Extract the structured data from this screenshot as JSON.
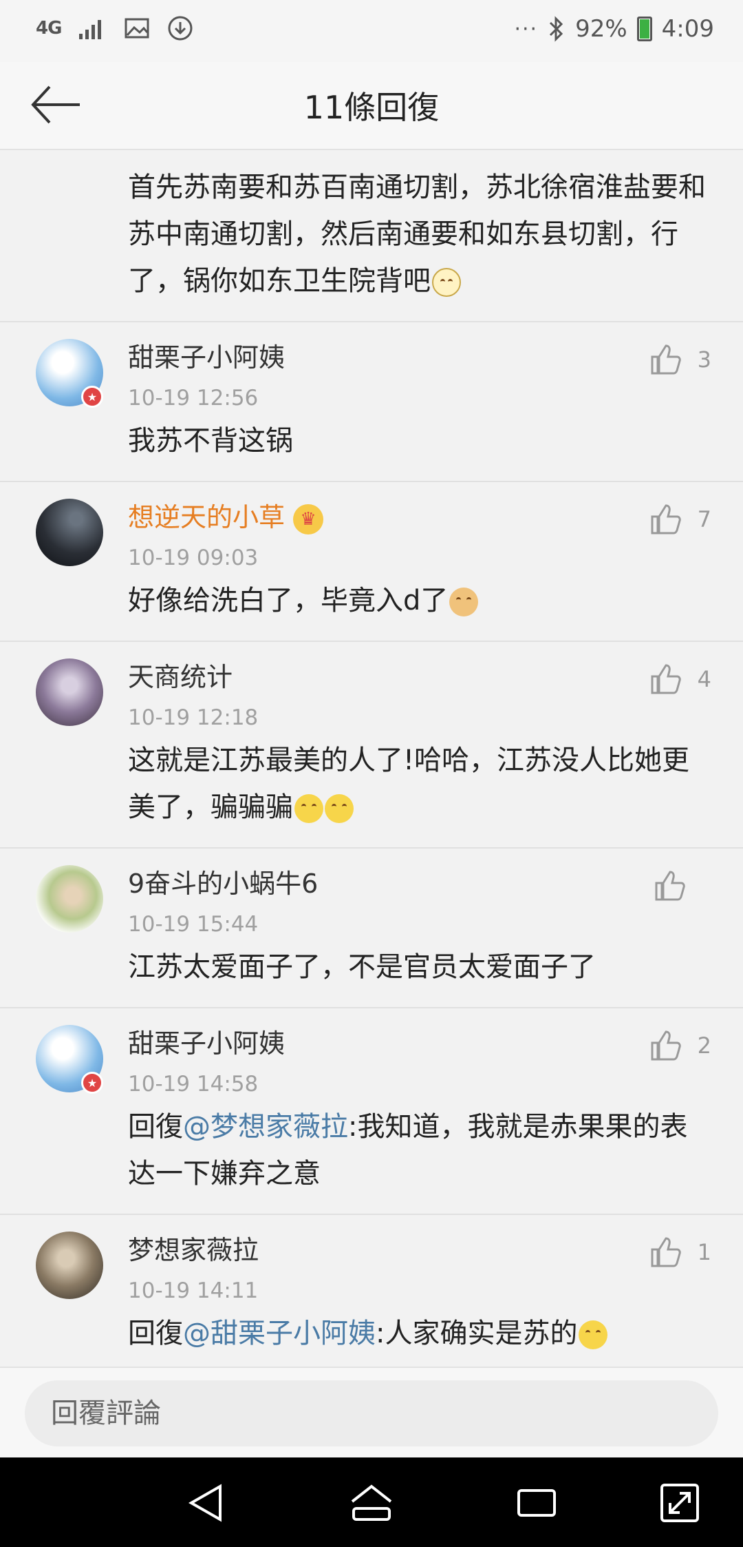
{
  "status_bar": {
    "network": "4G",
    "battery_pct": "92%",
    "time": "4:09",
    "battery_level": 0.92
  },
  "header": {
    "title": "11條回復"
  },
  "top_comment": {
    "text": "首先苏南要和苏百南通切割，苏北徐宿淮盐要和苏中南通切割，然后南通要和如东县切割，行了，锅你如东卫生院背吧"
  },
  "comments": [
    {
      "username": "甜栗子小阿姨",
      "time": "10-19 12:56",
      "likes": "3",
      "text": "我苏不背这锅"
    },
    {
      "username": "想逆天的小草",
      "time": "10-19 09:03",
      "likes": "7",
      "text": "好像给洗白了，毕竟入d了"
    },
    {
      "username": "天商统计",
      "time": "10-19 12:18",
      "likes": "4",
      "text": "这就是江苏最美的人了!哈哈，江苏没人比她更美了，骗骗骗"
    },
    {
      "username": "9奋斗的小蜗牛6",
      "time": "10-19 15:44",
      "likes": "",
      "text": "江苏太爱面子了，不是官员太爱面子了"
    },
    {
      "username": "甜栗子小阿姨",
      "time": "10-19 14:58",
      "likes": "2",
      "reply_prefix": "回復",
      "mention": "@梦想家薇拉",
      "text": ":我知道，我就是赤果果的表达一下嫌弃之意"
    },
    {
      "username": "梦想家薇拉",
      "time": "10-19 14:11",
      "likes": "1",
      "reply_prefix": "回復",
      "mention": "@甜栗子小阿姨",
      "text": ":人家确实是苏的"
    }
  ],
  "reply_bar": {
    "placeholder": "回覆評論"
  },
  "colors": {
    "mention": "#4a7ba6",
    "vip_name": "#e67e22",
    "battery": "#3cb043"
  }
}
